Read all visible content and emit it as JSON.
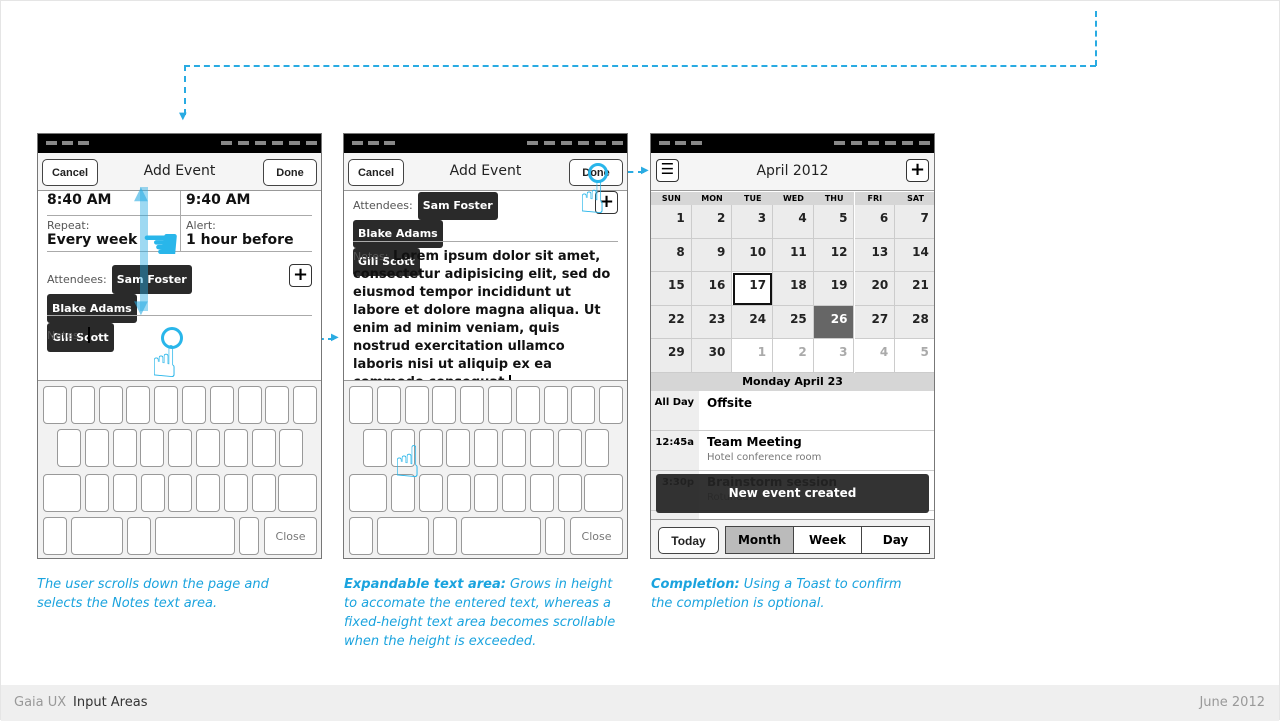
{
  "colors": {
    "accent": "#29abe2",
    "caption": "#1aa3de",
    "selected_day": "#666666"
  },
  "phone1": {
    "cancel": "Cancel",
    "title": "Add Event",
    "done": "Done",
    "start": "8:40 AM",
    "end": "9:40 AM",
    "repeat_label": "Repeat:",
    "repeat": "Every week",
    "alert_label": "Alert:",
    "alert": "1 hour before",
    "attendees_label": "Attendees:",
    "attendees": [
      "Sam Foster",
      "Blake Adams",
      "Gill Scott"
    ],
    "notes_label": "Notes:",
    "close": "Close"
  },
  "phone2": {
    "cancel": "Cancel",
    "title": "Add Event",
    "done": "Done",
    "attendees_label": "Attendees:",
    "attendees": [
      "Sam Foster",
      "Blake Adams",
      "Gill Scott"
    ],
    "notes_label": "Notes:",
    "notes": "Lorem ipsum dolor sit amet, consectetur adipisicing elit, sed do eiusmod tempor incididunt ut labore et dolore magna aliqua. Ut enim ad minim veniam, quis nostrud exercitation ullamco laboris nisi ut aliquip ex ea commodo consequat.",
    "close": "Close"
  },
  "phone3": {
    "title": "April 2012",
    "weekdays": [
      "SUN",
      "MON",
      "TUE",
      "WED",
      "THU",
      "FRI",
      "SAT"
    ],
    "weeks": [
      [
        "1",
        "2",
        "3",
        "4",
        "5",
        "6",
        "7"
      ],
      [
        "8",
        "9",
        "10",
        "11",
        "12",
        "13",
        "14"
      ],
      [
        "15",
        "16",
        "17",
        "18",
        "19",
        "20",
        "21"
      ],
      [
        "22",
        "23",
        "24",
        "25",
        "26",
        "27",
        "28"
      ],
      [
        "29",
        "30",
        "1",
        "2",
        "3",
        "4",
        "5"
      ]
    ],
    "today": "17",
    "selected": "26",
    "day_header": "Monday April 23",
    "events": [
      {
        "time": "All Day",
        "title": "Offsite",
        "sub": ""
      },
      {
        "time": "12:45a",
        "title": "Team Meeting",
        "sub": "Hotel conference room"
      },
      {
        "time": "3:30p",
        "title": "Brainstorm session",
        "sub": "Rotunda"
      }
    ],
    "toast": "New event created",
    "today_btn": "Today",
    "views": [
      "Month",
      "Week",
      "Day"
    ],
    "active_view": "Month"
  },
  "captions": {
    "c1": "The user scrolls down the page and selects the Notes text area.",
    "c2_bold": "Expandable text area:",
    "c2": " Grows in height to accomate the entered text, whereas a fixed-height text area becomes scrollable when the height is exceeded.",
    "c3_bold": "Completion:",
    "c3": " Using a Toast to confirm the completion is optional."
  },
  "footer": {
    "brand": "Gaia UX",
    "section": "Input Areas",
    "date": "June 2012"
  }
}
